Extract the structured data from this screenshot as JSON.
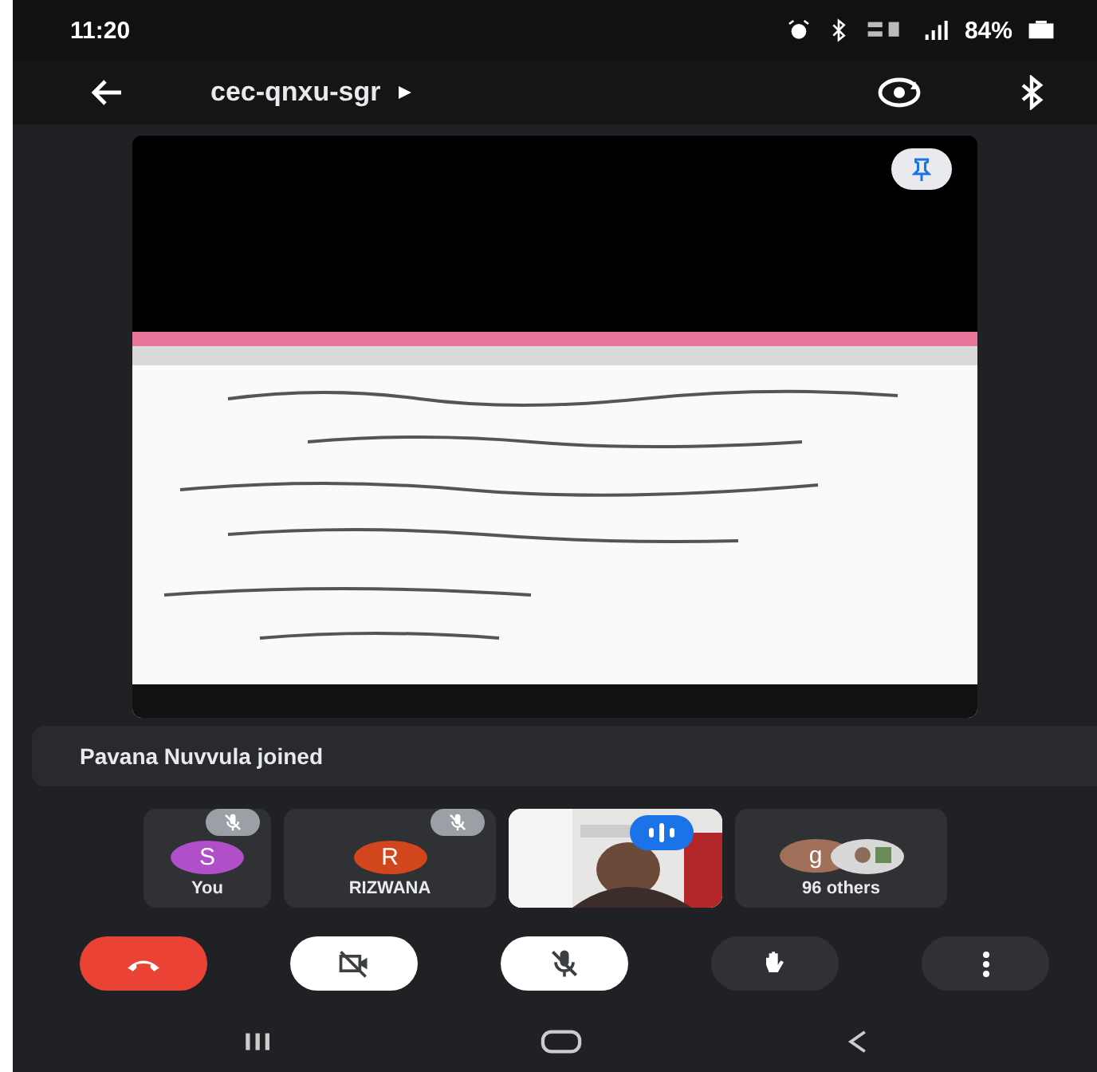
{
  "status_bar": {
    "time": "11:20",
    "battery": "84%"
  },
  "app_bar": {
    "title": "cec-qnxu-sgr"
  },
  "notification": {
    "text": "Pavana Nuvvula joined"
  },
  "participants": [
    {
      "kind": "avatar",
      "initial": "S",
      "name": "You",
      "color": "#b04fc9",
      "muted": true
    },
    {
      "kind": "avatar",
      "initial": "R",
      "name": "RIZWANA",
      "color": "#d2461e",
      "muted": true
    },
    {
      "kind": "video",
      "speaking": true
    },
    {
      "kind": "group",
      "initial": "g",
      "name": "96 others",
      "color": "#a0705a"
    }
  ],
  "controls": [
    {
      "kind": "end"
    },
    {
      "kind": "camera",
      "on": false
    },
    {
      "kind": "mic",
      "on": false
    },
    {
      "kind": "hand",
      "on": false
    },
    {
      "kind": "more"
    }
  ]
}
